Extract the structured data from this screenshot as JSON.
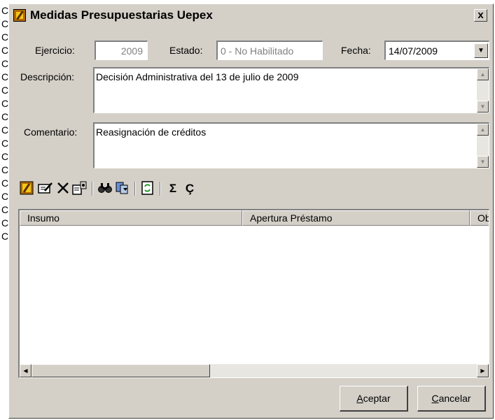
{
  "background_chars": [
    "C",
    "C",
    "C",
    "C",
    "C",
    "C",
    "C",
    "C",
    "C",
    "C",
    "C",
    "C",
    "C",
    "C",
    "C",
    "C",
    "C",
    "C"
  ],
  "window": {
    "title": "Medidas Presupuestarias Uepex",
    "close_label": "x"
  },
  "form": {
    "ejercicio_label": "Ejercicio:",
    "ejercicio_value": "2009",
    "estado_label": "Estado:",
    "estado_value": "0 - No Habilitado",
    "fecha_label": "Fecha:",
    "fecha_value": "14/07/2009",
    "descripcion_label": "Descripción:",
    "descripcion_value": "Decisión Administrativa del 13 de julio de 2009",
    "comentario_label": "Comentario:",
    "comentario_value": "Reasignación de créditos"
  },
  "toolbar": {
    "icons": [
      "app-icon",
      "edit-icon",
      "delete-icon",
      "properties-icon",
      "find-icon",
      "filter-icon",
      "refresh-icon",
      "sum-icon",
      "cedilla-icon"
    ],
    "sum_glyph": "Σ",
    "cedilla_glyph": "Ç"
  },
  "grid": {
    "columns": [
      "Insumo",
      "Apertura Préstamo",
      "Obje"
    ]
  },
  "buttons": {
    "accept_accel": "A",
    "accept_rest": "ceptar",
    "cancel_accel": "C",
    "cancel_rest": "ancelar"
  }
}
